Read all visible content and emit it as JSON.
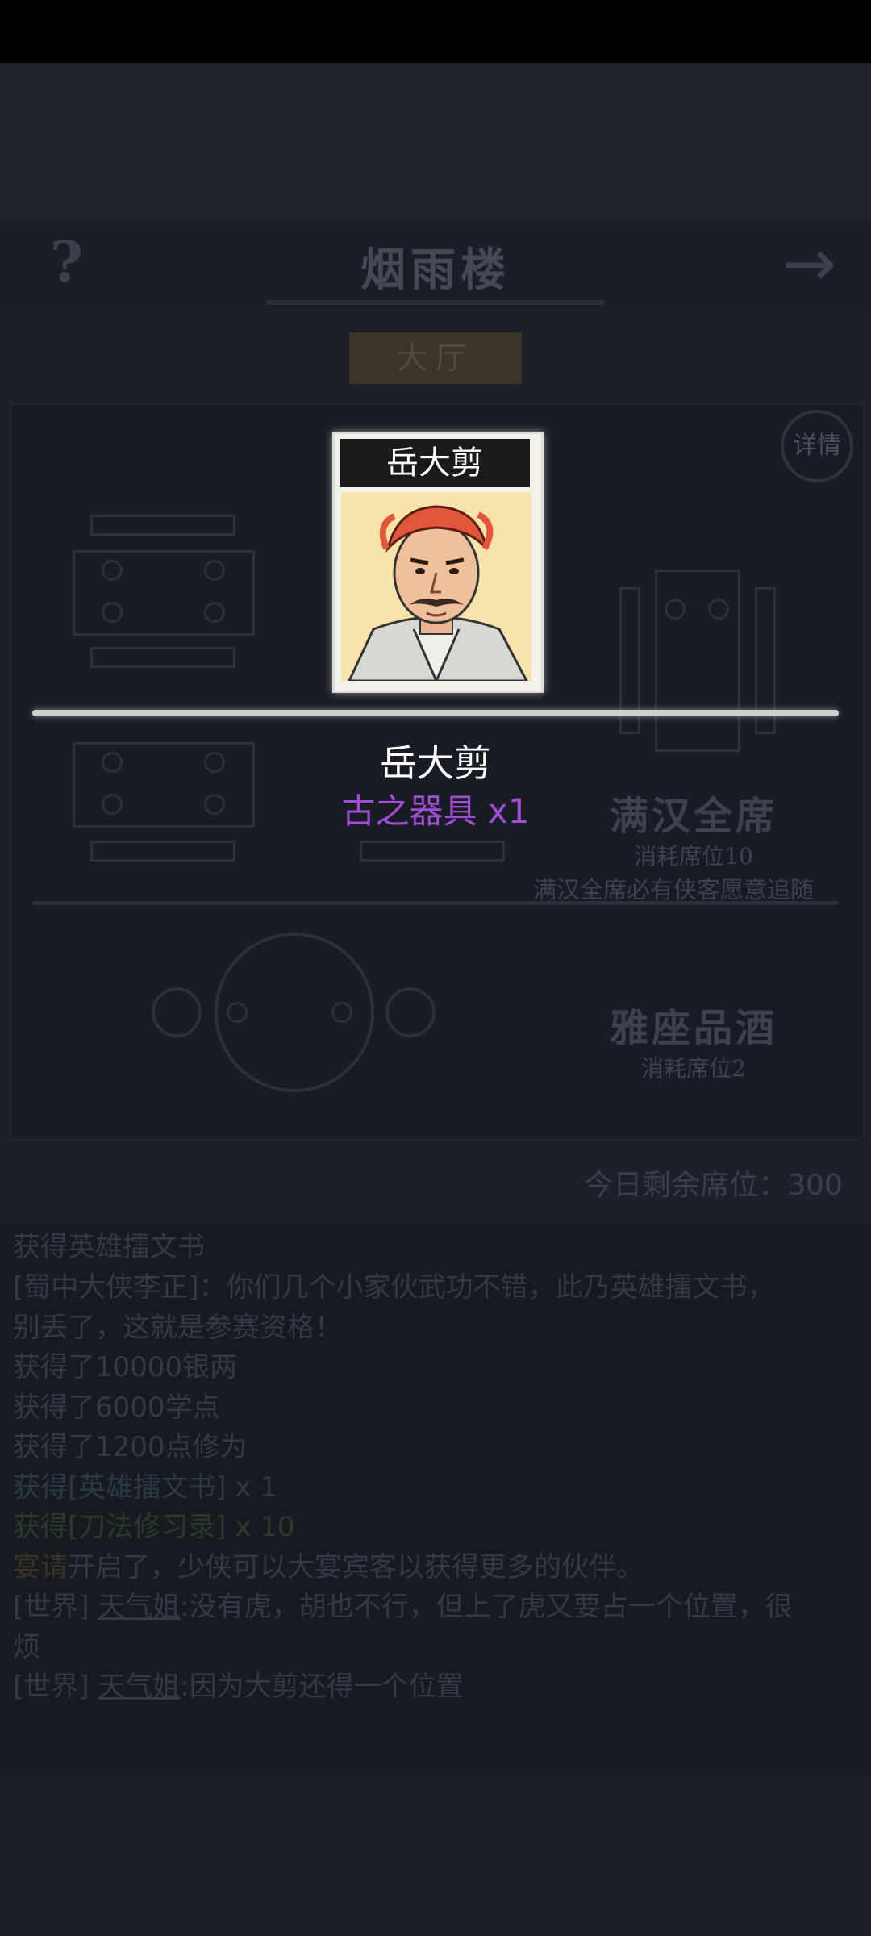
{
  "header": {
    "help_icon": "?",
    "title": "烟雨楼",
    "arrow_icon": "→"
  },
  "tabs": {
    "hall": "大厅"
  },
  "details_button": "详情",
  "feast": {
    "title": "满汉全席",
    "cost": "消耗席位10",
    "description": "满汉全席必有侠客愿意追随"
  },
  "wine": {
    "title": "雅座品酒",
    "cost": "消耗席位2"
  },
  "seats_remaining": "今日剩余席位：300",
  "reward": {
    "card_name": "岳大剪",
    "name": "岳大剪",
    "item": "古之器具 x1",
    "item_color": "#a44cd6"
  },
  "log": [
    {
      "text": "获得英雄擂文书"
    },
    {
      "text": "[蜀中大侠李正]：你们几个小家伙武功不错，此乃英雄擂文书，"
    },
    {
      "text": "别丢了，这就是参赛资格！"
    },
    {
      "text": "获得了10000银两"
    },
    {
      "text": "获得了6000学点"
    },
    {
      "text": "获得了1200点修为"
    },
    {
      "text": "获得[英雄擂文书] x 1"
    },
    {
      "text": "获得[刀法修习录] x 10"
    },
    {
      "prefix": "宴请",
      "text": "开启了，少侠可以大宴宾客以获得更多的伙伴。"
    },
    {
      "prefix": "[世界] ",
      "user": "天气姐",
      "text": ":没有虎，胡也不行，但上了虎又要占一个位置，很"
    },
    {
      "text": "烦"
    },
    {
      "prefix": "[世界] ",
      "user": "天气姐",
      "text": ":因为大剪还得一个位置"
    }
  ]
}
